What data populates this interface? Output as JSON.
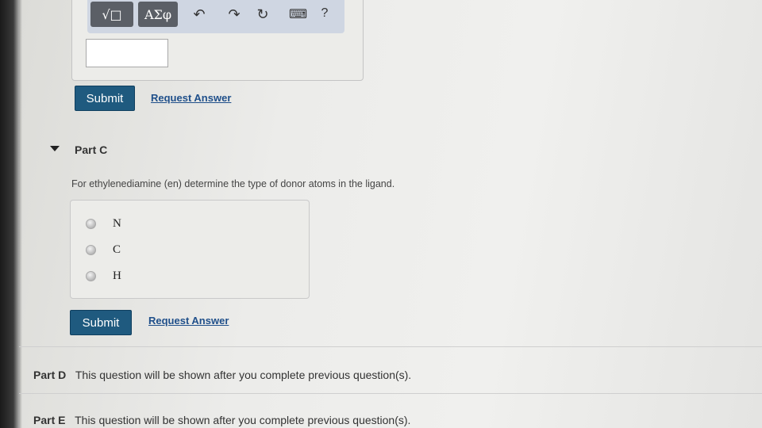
{
  "toolbar": {
    "templates_label": "√□",
    "symbols_label": "ΑΣφ",
    "undo_icon": "↶",
    "redo_icon": "↷",
    "reset_icon": "↻",
    "keyboard_icon": "⌨",
    "help_label": "?"
  },
  "part_b": {
    "submit_label": "Submit",
    "request_answer_label": "Request Answer"
  },
  "part_c": {
    "title": "Part C",
    "question": "For ethylenediamine (en) determine the type of donor atoms in the ligand.",
    "options": [
      "N",
      "C",
      "H"
    ],
    "submit_label": "Submit",
    "request_answer_label": "Request Answer"
  },
  "part_d": {
    "title": "Part D",
    "message": "This question will be shown after you complete previous question(s)."
  },
  "part_e": {
    "title": "Part E",
    "message": "This question will be shown after you complete previous question(s)."
  }
}
